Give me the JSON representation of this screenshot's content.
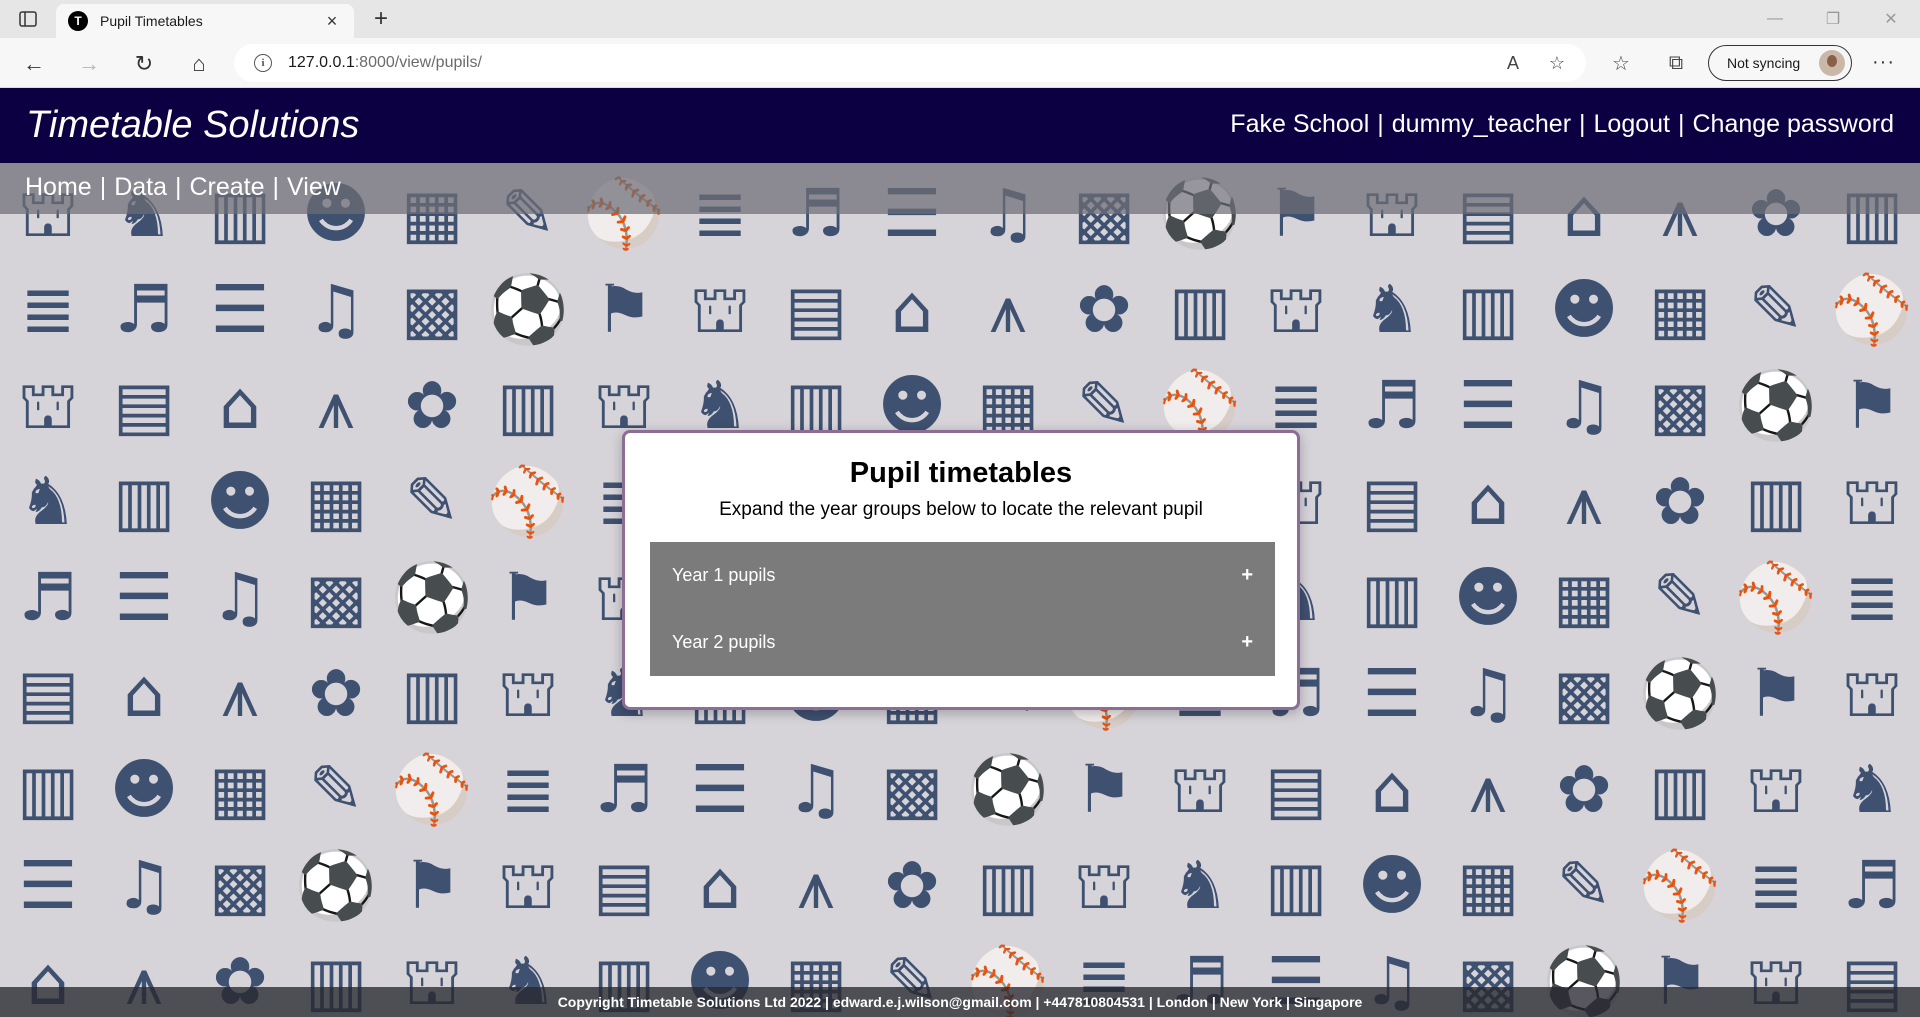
{
  "browser": {
    "tab_title": "Pupil Timetables",
    "favicon_letter": "T",
    "url_host": "127.0.0.1",
    "url_rest": ":8000/view/pupils/",
    "sync_label": "Not syncing"
  },
  "header": {
    "site_title": "Timetable Solutions",
    "school": "Fake School",
    "user": "dummy_teacher",
    "logout": "Logout",
    "change_password": "Change password",
    "separator": "|"
  },
  "nav": {
    "home": "Home",
    "data": "Data",
    "create": "Create",
    "view": "View",
    "separator": "|"
  },
  "card": {
    "title": "Pupil timetables",
    "subtitle": "Expand the year groups below to locate the relevant pupil",
    "year_groups": [
      {
        "label": "Year 1 pupils",
        "toggle": "+"
      },
      {
        "label": "Year 2 pupils",
        "toggle": "+"
      }
    ]
  },
  "footer": {
    "text": "Copyright Timetable Solutions Ltd 2022 | edward.e.j.wilson@gmail.com | +447810804531 | London | New York | Singapore"
  },
  "colors": {
    "header_bg": "#0c0043",
    "nav_bar": "#6e6e76",
    "background_icon": "#3f5170",
    "accordion_bg": "#7b7b7b",
    "card_border": "#8b6d95"
  },
  "background_icons": [
    "playground",
    "rocking-horse",
    "books",
    "theatre-masks",
    "abacus",
    "pencil",
    "cricket",
    "xylophone",
    "piano",
    "book-stack",
    "music-note",
    "calculator",
    "football",
    "teacher",
    "playground",
    "notebook",
    "school",
    "compass",
    "palette",
    "books"
  ]
}
